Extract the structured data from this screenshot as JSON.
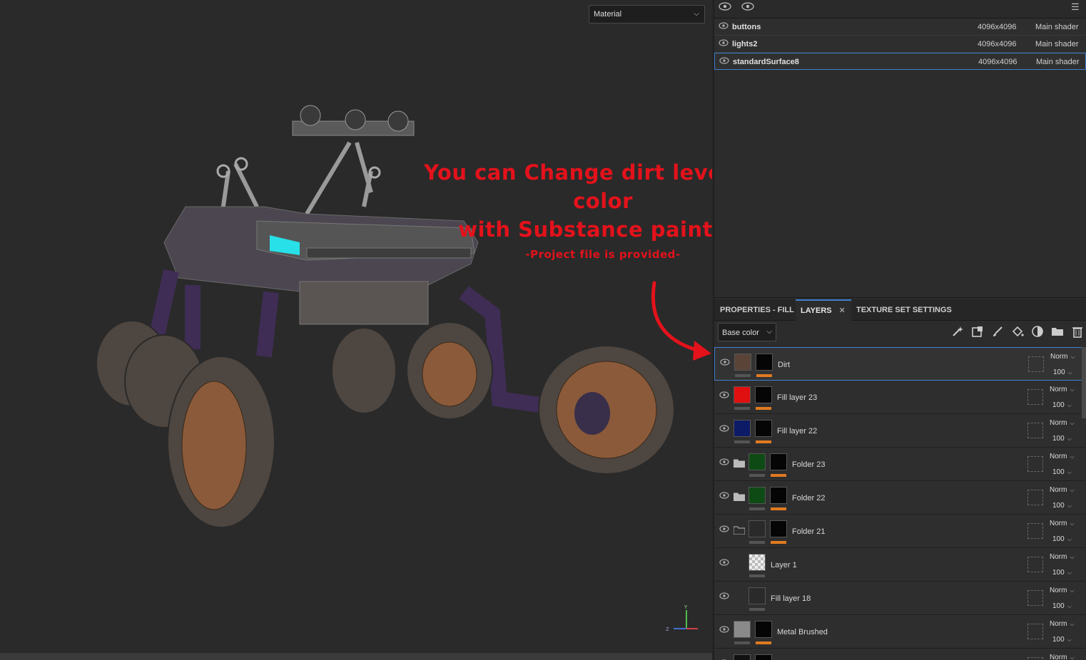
{
  "viewport": {
    "material_select": "Material",
    "promo_line1": "You can Change dirt level and color",
    "promo_line2": "with Substance painter!",
    "promo_line3": "-Project file is provided-",
    "axis": {
      "y": "Y",
      "z": "Z"
    }
  },
  "texture_sets": [
    {
      "name": "buttons",
      "resolution": "4096x4096",
      "shader": "Main shader",
      "selected": false
    },
    {
      "name": "lights2",
      "resolution": "4096x4096",
      "shader": "Main shader",
      "selected": false
    },
    {
      "name": "standardSurface8",
      "resolution": "4096x4096",
      "shader": "Main shader",
      "selected": true
    }
  ],
  "tabs": [
    {
      "label": "PROPERTIES - FILL",
      "active": false
    },
    {
      "label": "LAYERS",
      "active": true,
      "close": "✕"
    },
    {
      "label": "TEXTURE SET SETTINGS",
      "active": false
    }
  ],
  "channel_select": "Base color",
  "tools": [
    "wand-icon",
    "effect-icon",
    "paint-brush-icon",
    "fill-bucket-icon",
    "smart-material-icon",
    "folder-icon",
    "trash-icon"
  ],
  "layers": [
    {
      "name": "Dirt",
      "blend": "Norm",
      "opacity": "100",
      "type": "fill",
      "color": "#5a4438",
      "selected": true
    },
    {
      "name": "Fill layer 23",
      "blend": "Norm",
      "opacity": "100",
      "type": "fill",
      "color": "#e01010",
      "selected": false
    },
    {
      "name": "Fill layer 22",
      "blend": "Norm",
      "opacity": "100",
      "type": "fill",
      "color": "#0d1a66",
      "selected": false
    },
    {
      "name": "Folder 23",
      "blend": "Norm",
      "opacity": "100",
      "type": "folder",
      "color": "#0e4a14",
      "selected": false
    },
    {
      "name": "Folder 22",
      "blend": "Norm",
      "opacity": "100",
      "type": "folder",
      "color": "#0e4a14",
      "selected": false
    },
    {
      "name": "Folder 21",
      "blend": "Norm",
      "opacity": "100",
      "type": "folder-open",
      "color": "#2a2a2a",
      "selected": false
    },
    {
      "name": "Layer 1",
      "blend": "Norm",
      "opacity": "100",
      "type": "paint",
      "color": "#cccccc",
      "selected": false
    },
    {
      "name": "Fill layer 18",
      "blend": "Norm",
      "opacity": "100",
      "type": "fill-empty",
      "color": "#2a2a2a",
      "selected": false
    },
    {
      "name": "Metal Brushed",
      "blend": "Norm",
      "opacity": "100",
      "type": "fill",
      "color": "#8a8a8a",
      "selected": false
    },
    {
      "name": "",
      "blend": "Norm",
      "opacity": "",
      "type": "fill",
      "color": "#111111",
      "selected": false
    }
  ]
}
